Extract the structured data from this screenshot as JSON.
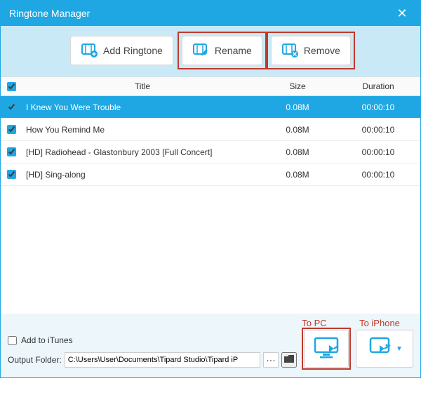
{
  "window": {
    "title": "Ringtone Manager"
  },
  "toolbar": {
    "add_label": "Add Ringtone",
    "rename_label": "Rename",
    "remove_label": "Remove"
  },
  "columns": {
    "title": "Title",
    "size": "Size",
    "duration": "Duration"
  },
  "rows": [
    {
      "title": "I Knew You Were Trouble",
      "size": "0.08M",
      "duration": "00:00:10",
      "checked": true,
      "selected": true
    },
    {
      "title": "How You Remind Me",
      "size": "0.08M",
      "duration": "00:00:10",
      "checked": true,
      "selected": false
    },
    {
      "title": "[HD] Radiohead - Glastonbury 2003 [Full Concert]",
      "size": "0.08M",
      "duration": "00:00:10",
      "checked": true,
      "selected": false
    },
    {
      "title": "[HD] Sing-along",
      "size": "0.08M",
      "duration": "00:00:10",
      "checked": true,
      "selected": false
    }
  ],
  "annotations": {
    "to_pc": "To PC",
    "to_iphone": "To iPhone"
  },
  "footer": {
    "add_to_itunes_label": "Add to iTunes",
    "output_folder_label": "Output Folder:",
    "output_folder_value": "C:\\Users\\User\\Documents\\Tipard Studio\\Tipard iP",
    "ellipsis": "···"
  },
  "icons": {
    "film": "film-plus-icon",
    "film_edit": "film-edit-icon",
    "film_remove": "film-remove-icon",
    "folder": "folder-icon",
    "monitor": "to-pc-icon",
    "phone": "to-iphone-icon"
  },
  "colors": {
    "primary": "#1ea7e2",
    "highlight": "#c0392b"
  }
}
